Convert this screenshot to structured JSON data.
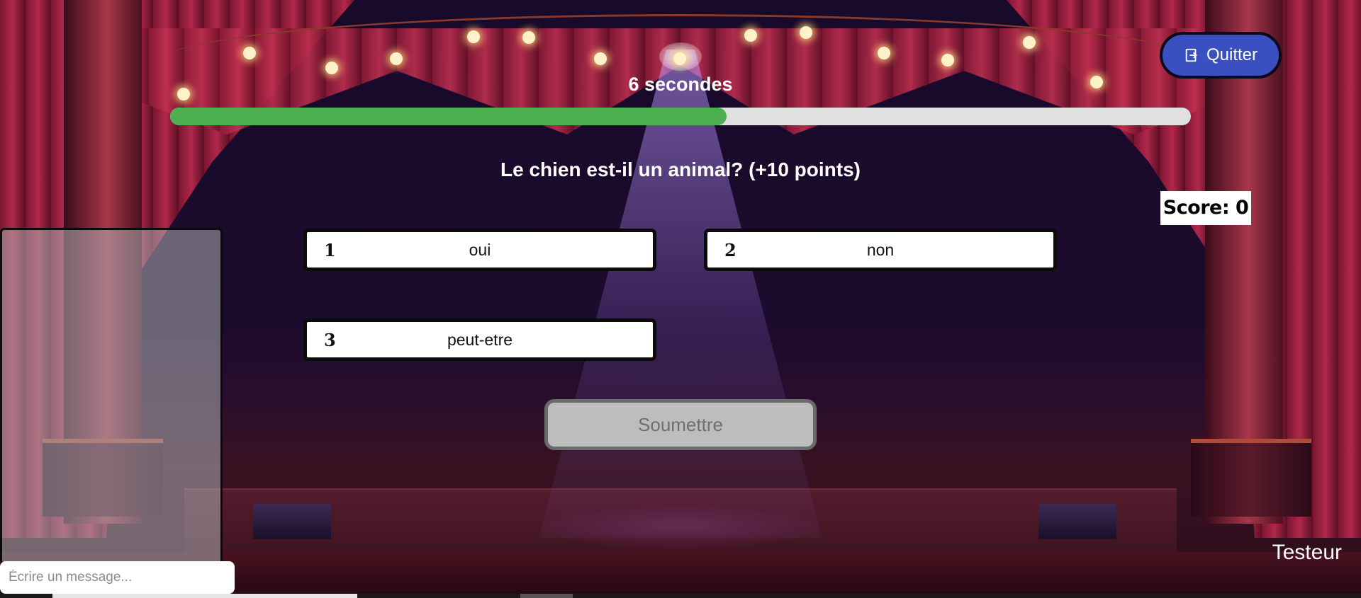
{
  "timer": {
    "text": "6 secondes",
    "progress_fraction": 0.545
  },
  "question": {
    "text": "Le chien est-il un animal? (+10 points)"
  },
  "score": {
    "text": "Score: 0"
  },
  "quit_button": {
    "label": "Quitter",
    "icon": "exit-icon"
  },
  "answers": [
    {
      "number": "1",
      "label": "oui"
    },
    {
      "number": "2",
      "label": "non"
    },
    {
      "number": "3",
      "label": "peut-etre"
    }
  ],
  "submit_button": {
    "label": "Soumettre"
  },
  "chat": {
    "placeholder": "Écrire un message..."
  },
  "player": {
    "name": "Testeur"
  },
  "colors": {
    "progress": "#4caf50",
    "quit_button": "#3a4fc0",
    "submit_disabled": "#bdbdbd"
  }
}
